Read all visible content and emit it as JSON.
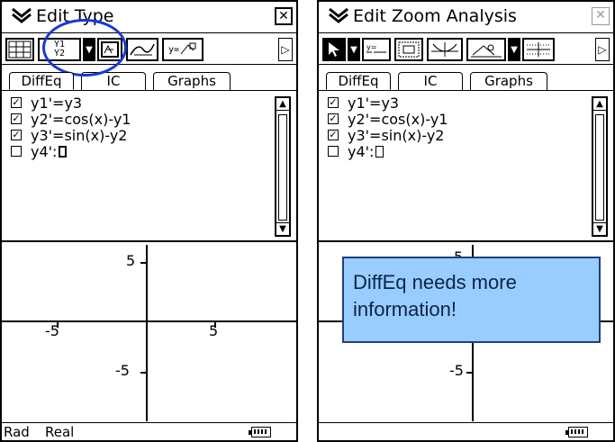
{
  "left": {
    "menu": "Edit Type",
    "tabs": [
      "DiffEq",
      "IC",
      "Graphs"
    ],
    "equations": [
      {
        "text": "y1'=y3",
        "checked": true
      },
      {
        "text": "y2'=cos(x)-y1",
        "checked": true
      },
      {
        "text": "y3'=sin(x)-y2",
        "checked": true
      },
      {
        "text": "y4':",
        "checked": false
      }
    ],
    "graph_labels": {
      "top": "5",
      "left": "-5",
      "right": "5",
      "bottom": "-5"
    },
    "status": {
      "angle": "Rad",
      "mode": "Real"
    },
    "toolbar": {
      "t1": "Y1",
      "t2": "Y2",
      "t3": "y="
    }
  },
  "right": {
    "menu": "Edit Zoom Analysis",
    "tabs": [
      "DiffEq",
      "IC",
      "Graphs"
    ],
    "equations": [
      {
        "text": "y1'=y3",
        "checked": true
      },
      {
        "text": "y2'=cos(x)-y1",
        "checked": true
      },
      {
        "text": "y3'=sin(x)-y2",
        "checked": true
      },
      {
        "text": "y4':",
        "checked": false
      }
    ],
    "graph_labels": {
      "top": "5",
      "bottom": "-5"
    }
  },
  "message": "DiffEq needs more information!",
  "colors": {
    "highlight": "#1a37d6",
    "message_bg": "#99ccff"
  }
}
